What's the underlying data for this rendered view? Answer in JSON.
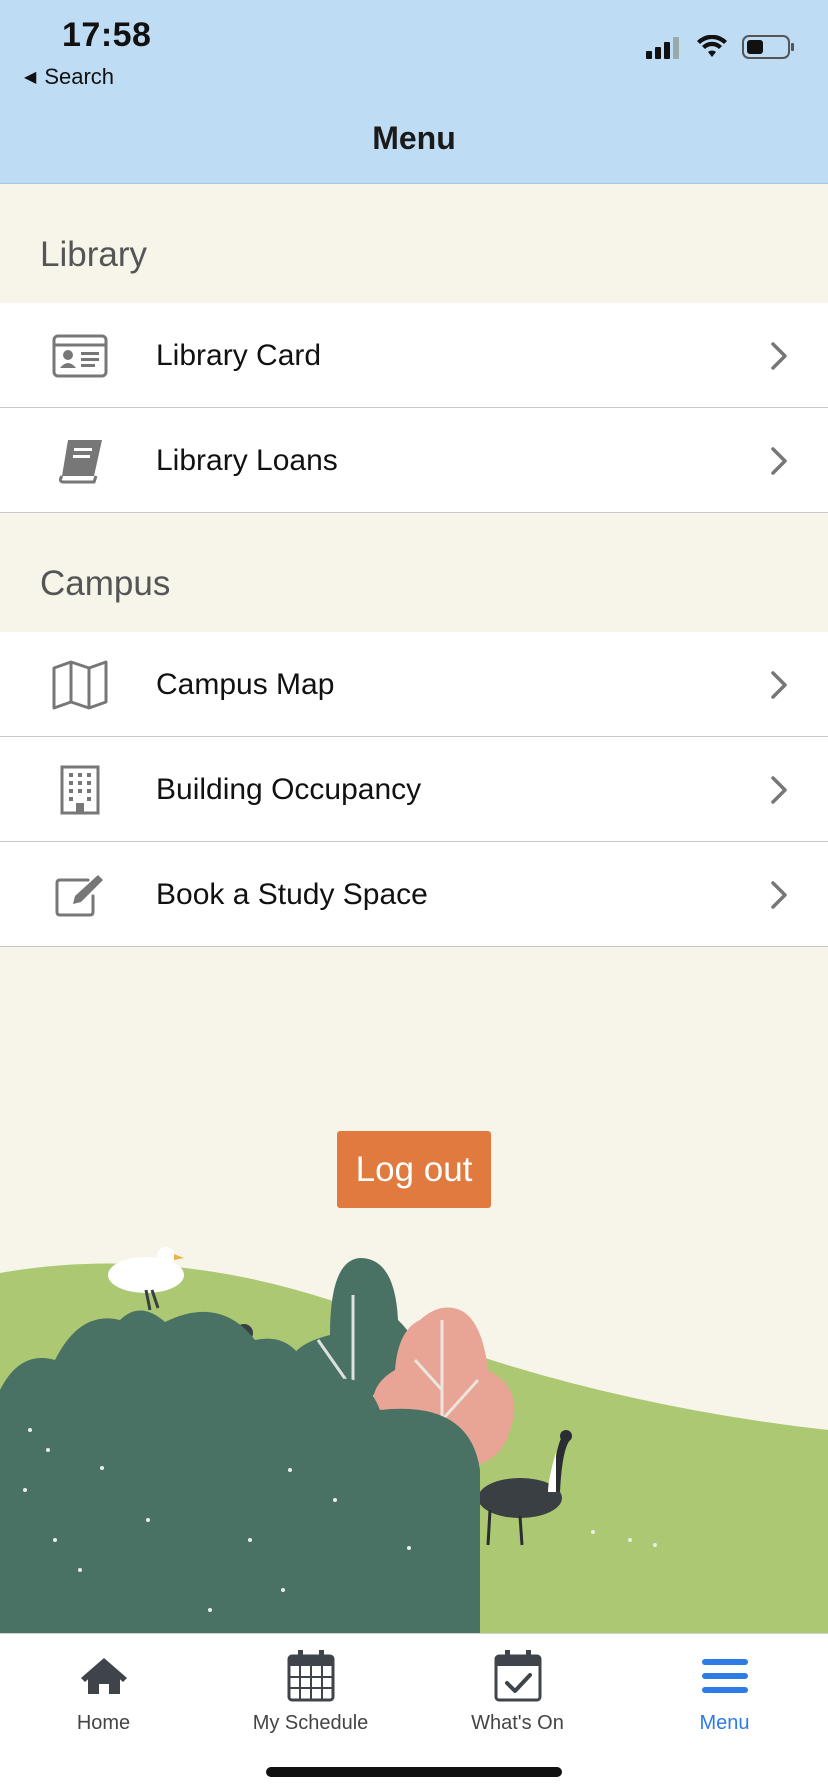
{
  "status_bar": {
    "time": "17:58",
    "back_label": "Search"
  },
  "nav": {
    "title": "Menu"
  },
  "sections": {
    "library": {
      "title": "Library",
      "items": [
        {
          "label": "Library Card",
          "icon": "id-card-icon"
        },
        {
          "label": "Library Loans",
          "icon": "book-icon"
        }
      ]
    },
    "campus": {
      "title": "Campus",
      "items": [
        {
          "label": "Campus Map",
          "icon": "map-icon"
        },
        {
          "label": "Building Occupancy",
          "icon": "building-icon"
        },
        {
          "label": "Book a Study Space",
          "icon": "edit-icon"
        }
      ]
    }
  },
  "logout": {
    "label": "Log out"
  },
  "tabbar": {
    "tabs": [
      {
        "label": "Home",
        "icon": "home-icon",
        "active": false
      },
      {
        "label": "My Schedule",
        "icon": "calendar-icon",
        "active": false
      },
      {
        "label": "What's On",
        "icon": "calendar-check-icon",
        "active": false
      },
      {
        "label": "Menu",
        "icon": "menu-icon",
        "active": true
      }
    ]
  },
  "colors": {
    "header_bg": "#bedcf3",
    "section_bg": "#f7f4e9",
    "logout_bg": "#e07a3f",
    "active_tab": "#2f7be5",
    "icon_gray": "#777777"
  }
}
